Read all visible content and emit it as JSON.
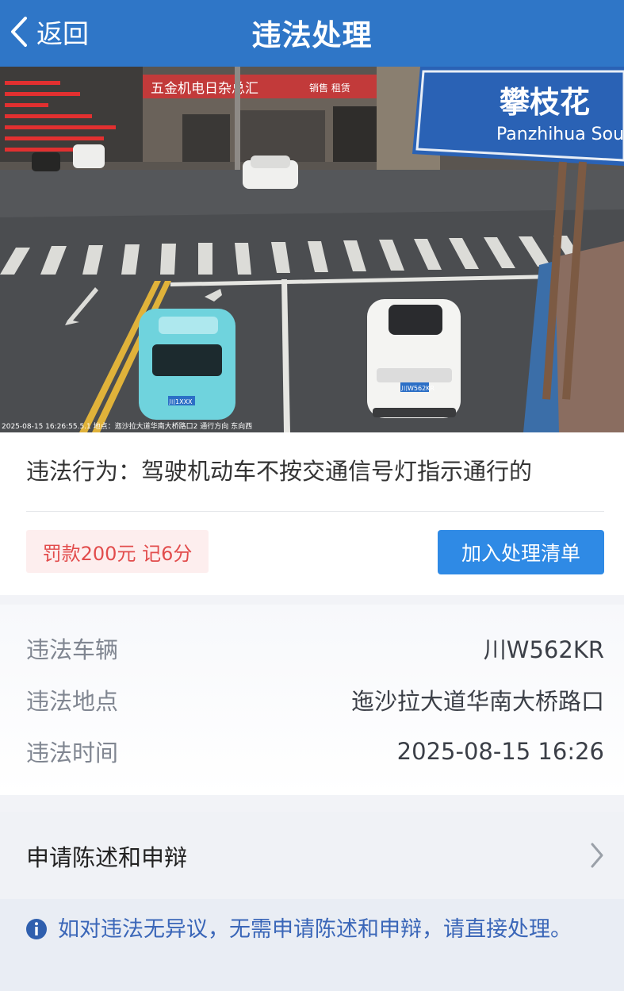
{
  "nav": {
    "back_label": "返回",
    "title": "违法处理"
  },
  "photo": {
    "sign_cn": "攀枝花",
    "sign_en": "Panzhihua South",
    "shop_sign": "五金机电日杂总汇",
    "shop_sub": "销售  租赁",
    "plate_left": "川1XXX",
    "plate_right": "川W562KR",
    "timestamp_caption": "2025-08-15 16:26:55.5.1 地点：迤沙拉大道华南大桥路口2 通行方向 东向西",
    "slide_count": 3,
    "active_slide": 1
  },
  "violation": {
    "behavior": "违法行为：驾驶机动车不按交通信号灯指示通行的",
    "penalty": "罚款200元 记6分",
    "add_button": "加入处理清单"
  },
  "details": [
    {
      "key": "违法车辆",
      "value": "川W562KR"
    },
    {
      "key": "违法地点",
      "value": "迤沙拉大道华南大桥路口"
    },
    {
      "key": "违法时间",
      "value": "2025-08-15 16:26"
    }
  ],
  "appeal": {
    "label": "申请陈述和申辩",
    "icon": "chevron-right-icon"
  },
  "notice": {
    "icon": "info-icon",
    "text": "如对违法无异议，无需申请陈述和申辩，请直接处理。"
  },
  "colors": {
    "nav": "#2f76c7",
    "button": "#2f8ae5",
    "penalty_text": "#e24c4c",
    "penalty_bg": "#fdeeee",
    "notice_text": "#3a66b8"
  }
}
